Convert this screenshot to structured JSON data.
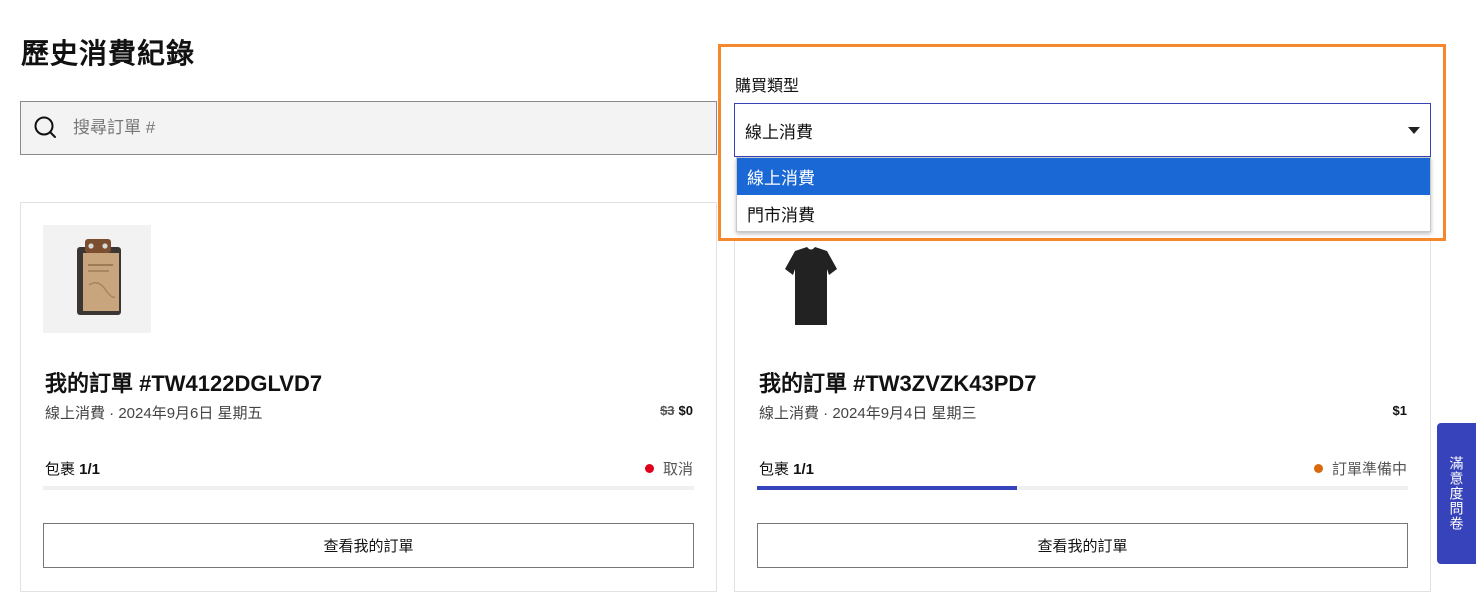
{
  "page": {
    "title": "歷史消費紀錄"
  },
  "search": {
    "placeholder": "搜尋訂單 #"
  },
  "filter": {
    "label": "購買類型",
    "selected": "線上消費",
    "options": [
      {
        "label": "線上消費",
        "highlighted": true
      },
      {
        "label": "門市消費",
        "highlighted": false
      }
    ]
  },
  "orders": [
    {
      "title": "我的訂單 #TW4122DGLVD7",
      "meta": "線上消費 · 2024年9月6日 星期五",
      "old_price": "$3",
      "price": "$0",
      "package_prefix": "包裹 ",
      "package_count": "1/1",
      "status": "取消",
      "status_color": "#e0001b",
      "progress": 0,
      "button": "查看我的訂單",
      "image_icon": "notebook-product-icon"
    },
    {
      "title": "我的訂單 #TW3ZVZK43PD7",
      "meta": "線上消費 · 2024年9月4日 星期三",
      "old_price": "",
      "price": "$1",
      "package_prefix": "包裹 ",
      "package_count": "1/1",
      "status": "訂單準備中",
      "status_color": "#d96a0b",
      "progress": 0.4,
      "button": "查看我的訂單",
      "image_icon": "tshirt-product-icon"
    }
  ],
  "feedback": {
    "label": "滿意度問卷"
  },
  "colors": {
    "brand": "#3643ba",
    "highlight": "#f5872c",
    "option_selected": "#1a68d6"
  }
}
